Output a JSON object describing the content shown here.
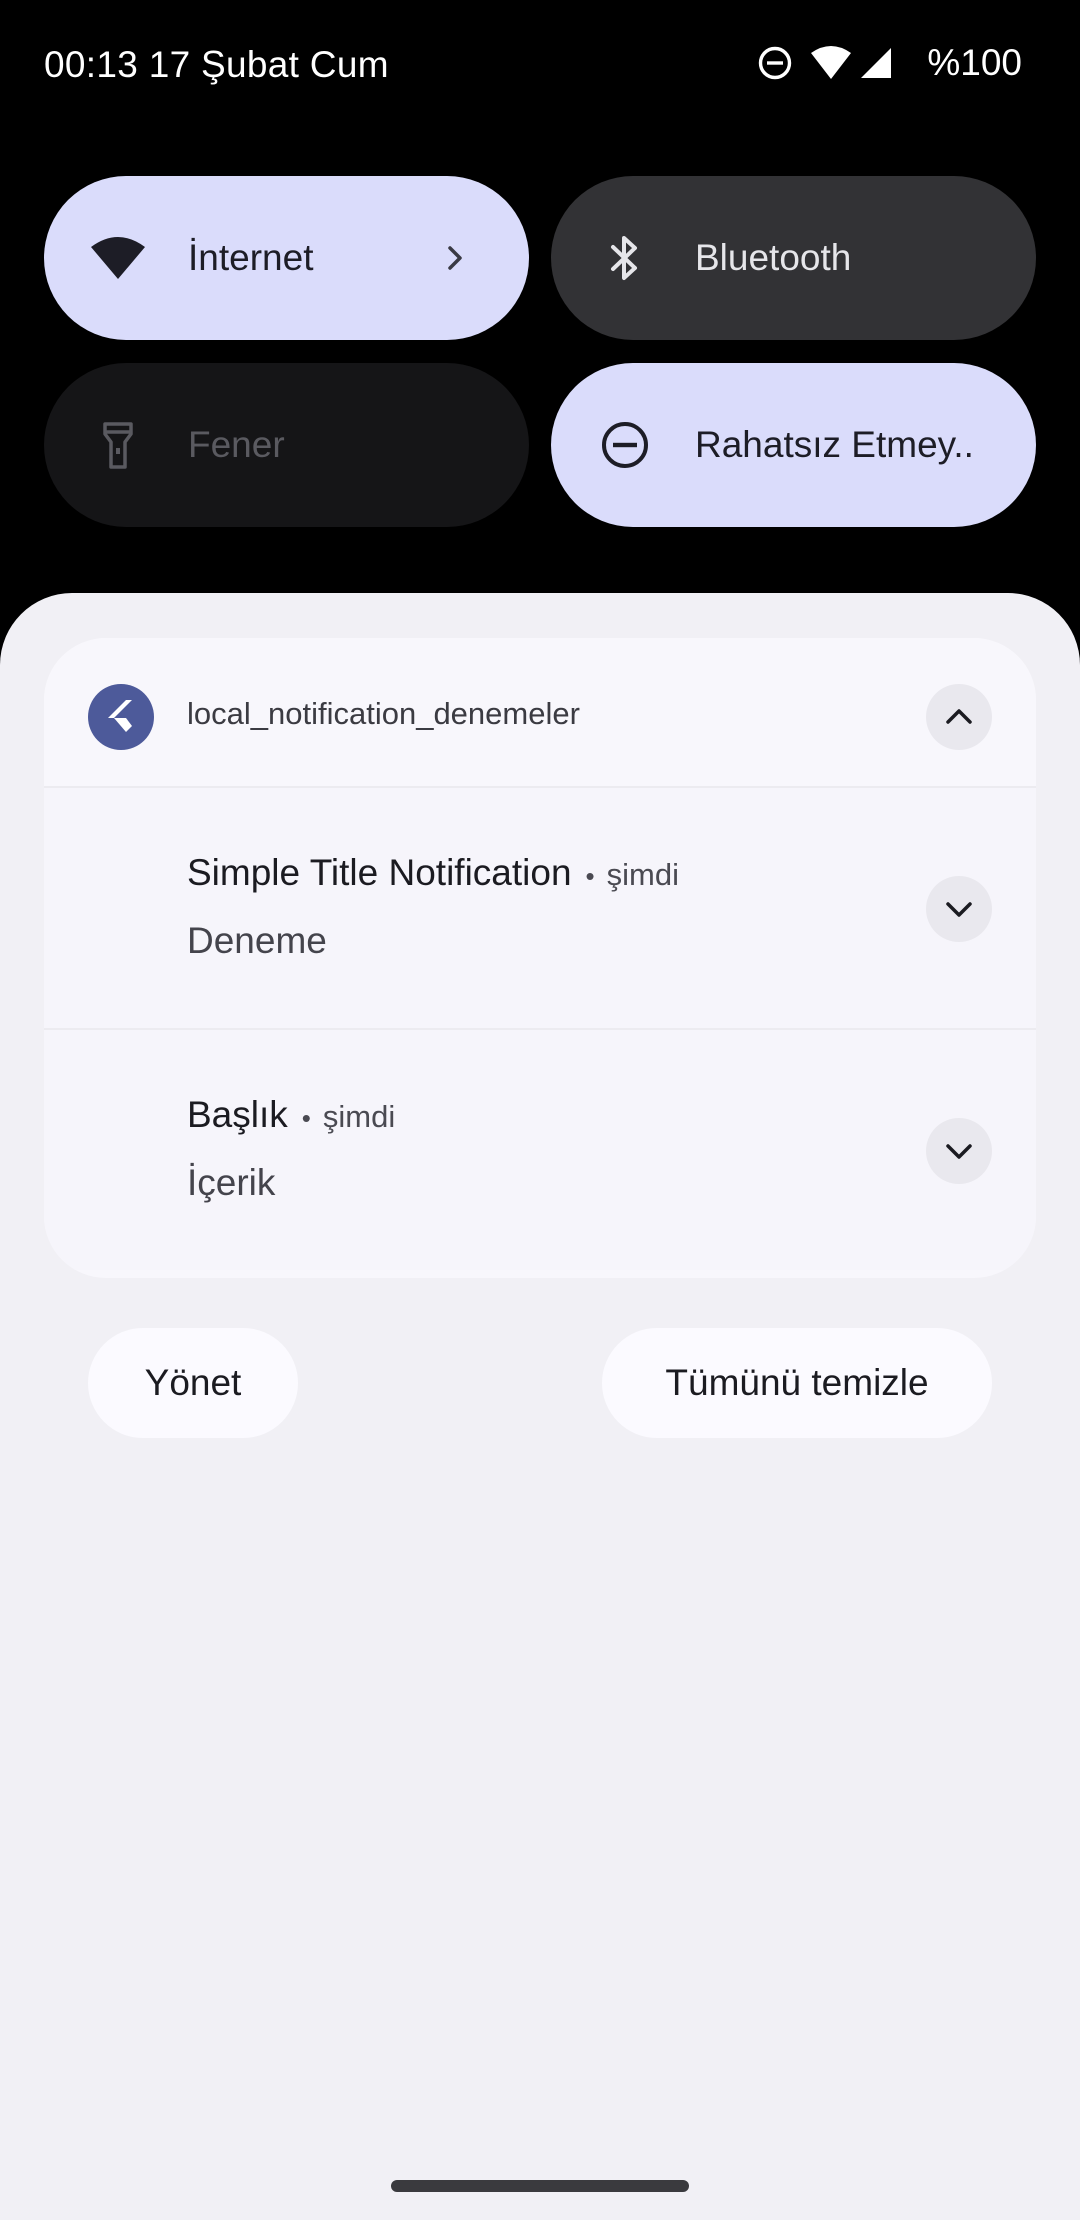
{
  "status_bar": {
    "time": "00:13",
    "date": "17 Şubat Cum",
    "battery": "%100",
    "icons": [
      "do-not-disturb-icon",
      "wifi-icon",
      "cell-signal-icon"
    ]
  },
  "quick_settings": {
    "tiles": [
      {
        "label": "İnternet",
        "icon": "wifi-icon",
        "state": "active"
      },
      {
        "label": "Bluetooth",
        "icon": "bluetooth-icon",
        "state": "off"
      },
      {
        "label": "Fener",
        "icon": "flashlight-icon",
        "state": "unavailable"
      },
      {
        "label": "Rahatsız Etmey..",
        "icon": "do-not-disturb-icon",
        "state": "active"
      }
    ]
  },
  "notification_group": {
    "app_name": "local_notification_denemeler",
    "app_icon": "flutter-icon",
    "notifications": [
      {
        "title": "Simple Title Notification",
        "time": "şimdi",
        "body": "Deneme"
      },
      {
        "title": "Başlık",
        "time": "şimdi",
        "body": "İçerik"
      }
    ]
  },
  "actions": {
    "manage_label": "Yönet",
    "clear_all_label": "Tümünü temizle"
  },
  "colors": {
    "active_tile": "#dadcfb",
    "inactive_tile": "#323235",
    "unavailable_tile": "#151517",
    "shade_background": "#f1f0f5",
    "app_icon_background": "#4d5a9a"
  }
}
